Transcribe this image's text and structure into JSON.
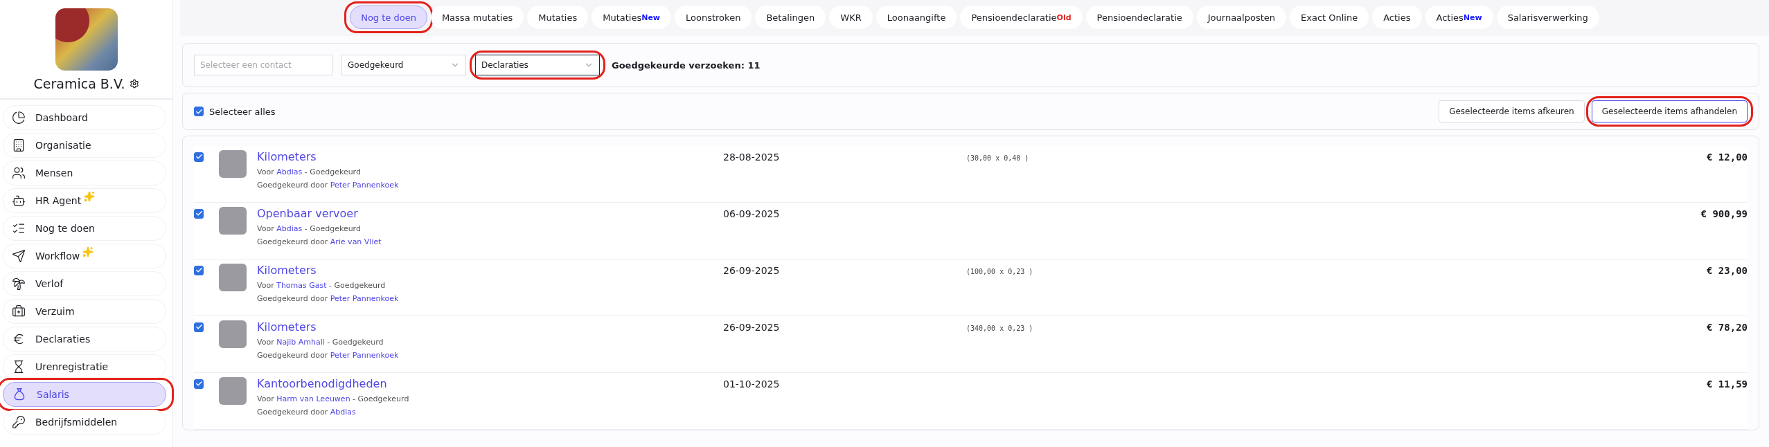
{
  "sidebar": {
    "company": "Ceramica B.V.",
    "items": [
      {
        "label": "Dashboard",
        "selected": false,
        "sparkle": false,
        "highlighted": false
      },
      {
        "label": "Organisatie",
        "selected": false,
        "sparkle": false,
        "highlighted": false
      },
      {
        "label": "Mensen",
        "selected": false,
        "sparkle": false,
        "highlighted": false
      },
      {
        "label": "HR Agent",
        "selected": false,
        "sparkle": true,
        "highlighted": false
      },
      {
        "label": "Nog te doen",
        "selected": false,
        "sparkle": false,
        "highlighted": false
      },
      {
        "label": "Workflow",
        "selected": false,
        "sparkle": true,
        "highlighted": false
      },
      {
        "label": "Verlof",
        "selected": false,
        "sparkle": false,
        "highlighted": false
      },
      {
        "label": "Verzuim",
        "selected": false,
        "sparkle": false,
        "highlighted": false
      },
      {
        "label": "Declaraties",
        "selected": false,
        "sparkle": false,
        "highlighted": false
      },
      {
        "label": "Urenregistratie",
        "selected": false,
        "sparkle": false,
        "highlighted": false
      },
      {
        "label": "Salaris",
        "selected": true,
        "sparkle": false,
        "highlighted": true
      },
      {
        "label": "Bedrijfsmiddelen",
        "selected": false,
        "sparkle": false,
        "highlighted": false
      }
    ]
  },
  "tabs": [
    {
      "label": "Nog te doen",
      "selected": true,
      "highlighted": true
    },
    {
      "label": "Massa mutaties",
      "selected": false,
      "highlighted": false
    },
    {
      "label": "Mutaties",
      "selected": false,
      "highlighted": false
    },
    {
      "label": "Mutaties",
      "badge": {
        "text": "New",
        "color": "#1a1aff"
      },
      "selected": false,
      "highlighted": false
    },
    {
      "label": "Loonstroken",
      "selected": false,
      "highlighted": false
    },
    {
      "label": "Betalingen",
      "selected": false,
      "highlighted": false
    },
    {
      "label": "WKR",
      "selected": false,
      "highlighted": false
    },
    {
      "label": "Loonaangifte",
      "selected": false,
      "highlighted": false
    },
    {
      "label": "Pensioendeclaratie",
      "badge": {
        "text": "Old",
        "color": "#e3221c"
      },
      "selected": false,
      "highlighted": false
    },
    {
      "label": "Pensioendeclaratie",
      "selected": false,
      "highlighted": false
    },
    {
      "label": "Journaalposten",
      "selected": false,
      "highlighted": false
    },
    {
      "label": "Exact Online",
      "selected": false,
      "highlighted": false
    },
    {
      "label": "Acties",
      "selected": false,
      "highlighted": false
    },
    {
      "label": "Acties",
      "badge": {
        "text": "New",
        "color": "#1a1aff"
      },
      "selected": false,
      "highlighted": false
    },
    {
      "label": "Salarisverwerking",
      "selected": false,
      "highlighted": false
    }
  ],
  "filters": {
    "contact": {
      "placeholder": "Selecteer een contact"
    },
    "selects": [
      {
        "value": "Goedgekeurd",
        "focused": false,
        "highlighted": false
      },
      {
        "value": "Declaraties",
        "focused": true,
        "highlighted": true
      }
    ],
    "count": "Goedgekeurde verzoeken: 11"
  },
  "actions": {
    "select_all": {
      "label": "Selecteer alles",
      "checked": true
    },
    "buttons": [
      {
        "label": "Geselecteerde items afkeuren",
        "primary": false,
        "highlighted": false
      },
      {
        "label": "Geselecteerde items afhandelen",
        "primary": true,
        "highlighted": true
      }
    ]
  },
  "rows": [
    {
      "checked": true,
      "title": "Kilometers",
      "for_prefix": "Voor",
      "person": "Abdias",
      "status_suffix": "- Goedgekeurd",
      "approved_prefix": "Goedgekeurd door",
      "approver": "Peter Pannenkoek",
      "date": "28-08-2025",
      "formula": "(30,00 x 0,40 )",
      "amount": "€ 12,00"
    },
    {
      "checked": true,
      "title": "Openbaar vervoer",
      "for_prefix": "Voor",
      "person": "Abdias",
      "status_suffix": "- Goedgekeurd",
      "approved_prefix": "Goedgekeurd door",
      "approver": "Arie van Vliet",
      "date": "06-09-2025",
      "amount": "€ 900,99"
    },
    {
      "checked": true,
      "title": "Kilometers",
      "for_prefix": "Voor",
      "person": "Thomas Gast",
      "status_suffix": "- Goedgekeurd",
      "approved_prefix": "Goedgekeurd door",
      "approver": "Peter Pannenkoek",
      "date": "26-09-2025",
      "formula": "(100,00 x 0,23 )",
      "amount": "€ 23,00"
    },
    {
      "checked": true,
      "title": "Kilometers",
      "for_prefix": "Voor",
      "person": "Najib Amhali",
      "status_suffix": "- Goedgekeurd",
      "approved_prefix": "Goedgekeurd door",
      "approver": "Peter Pannenkoek",
      "date": "26-09-2025",
      "formula": "(340,00 x 0,23 )",
      "amount": "€ 78,20"
    },
    {
      "checked": true,
      "title": "Kantoorbenodigdheden",
      "for_prefix": "Voor",
      "person": "Harm van Leeuwen",
      "status_suffix": "- Goedgekeurd",
      "approved_prefix": "Goedgekeurd door",
      "approver": "Abdias",
      "date": "01-10-2025",
      "amount": "€ 11,59"
    }
  ]
}
